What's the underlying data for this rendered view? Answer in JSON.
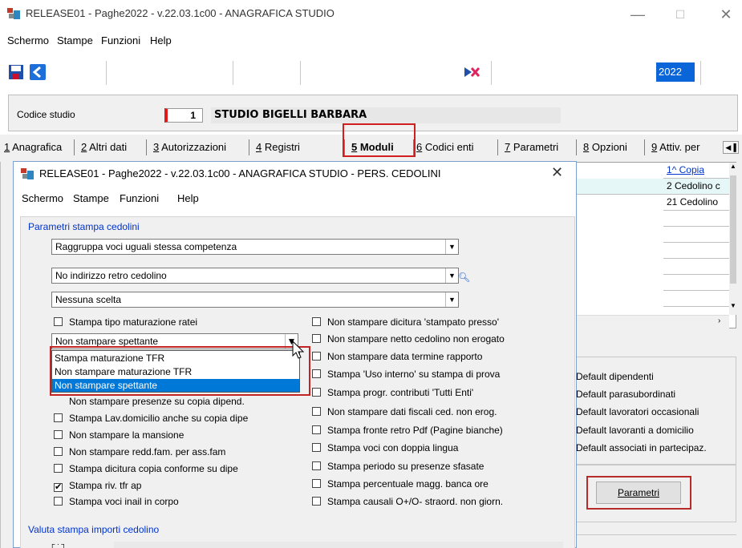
{
  "main": {
    "title": "RELEASE01 - Paghe2022 - v.22.03.1c00 - ANAGRAFICA STUDIO",
    "menu": [
      "Schermo",
      "Stampe",
      "Funzioni",
      "Help"
    ],
    "year": "2022",
    "studio_label": "Codice studio",
    "studio_code": "1",
    "studio_name": "STUDIO BIGELLI BARBARA"
  },
  "tabs": [
    {
      "num": "1",
      "label": " Anagrafica"
    },
    {
      "num": "2",
      "label": " Altri dati"
    },
    {
      "num": "3",
      "label": " Autorizzazioni"
    },
    {
      "num": "4",
      "label": " Registri"
    },
    {
      "num": "5",
      "label": " Moduli"
    },
    {
      "num": "6",
      "label": " Codici enti"
    },
    {
      "num": "7",
      "label": " Parametri"
    },
    {
      "num": "8",
      "label": " Opzioni"
    },
    {
      "num": "9",
      "label": " Attiv. per"
    }
  ],
  "grid": {
    "rows": [
      "1^ Copia",
      "2 Cedolino c",
      "21 Cedolino"
    ]
  },
  "defaults": [
    "Default dipendenti",
    "Default parasubordinati",
    "Default lavoratori occasionali",
    "Default lavoranti a domicilio",
    "Default associati in partecipaz."
  ],
  "parametri_button": "Parametri",
  "dialog": {
    "title": "RELEASE01 - Paghe2022 - v.22.03.1c00 - ANAGRAFICA STUDIO - PERS. CEDOLINI",
    "menu": [
      "Schermo",
      "Stampe",
      "Funzioni",
      "Help"
    ],
    "group_title": "Parametri stampa cedolini",
    "combo1": "Raggruppa voci uguali stessa competenza",
    "combo2": "No indirizzo retro cedolino",
    "combo3": "Nessuna scelta",
    "combo4": "Non stampare spettante",
    "dropdown_options": [
      "Stampa maturazione TFR",
      "Non stampare maturazione TFR",
      "Non stampare spettante"
    ],
    "left_checks": [
      {
        "label": "Stampa tipo maturazione ratei",
        "checked": false
      },
      {
        "label": "Non stampare presenze su copia dipend.",
        "checked": false
      },
      {
        "label": "Stampa Lav.domicilio anche su copia dipe",
        "checked": false
      },
      {
        "label": "Non stampare la mansione",
        "checked": false
      },
      {
        "label": "Non stampare redd.fam. per ass.fam",
        "checked": false
      },
      {
        "label": "Stampa dicitura copia conforme su dipe",
        "checked": false
      },
      {
        "label": "Stampa riv. tfr ap",
        "checked": true
      },
      {
        "label": "Stampa voci inail in corpo",
        "checked": false
      }
    ],
    "right_checks": [
      {
        "label": "Non stampare dicitura 'stampato presso'",
        "checked": false
      },
      {
        "label": "Non stampare netto cedolino non erogato",
        "checked": false
      },
      {
        "label": "Non stampare data termine rapporto",
        "checked": false
      },
      {
        "label": "Stampa 'Uso interno' su stampa di prova",
        "checked": false
      },
      {
        "label": "Stampa progr. contributi 'Tutti Enti'",
        "checked": false
      },
      {
        "label": "Non stampare dati fiscali ced. non erog.",
        "checked": false
      },
      {
        "label": "Stampa fronte retro Pdf (Pagine bianche)",
        "checked": false
      },
      {
        "label": "Stampa voci con doppia lingua",
        "checked": false
      },
      {
        "label": "Stampa periodo su presenze sfasate",
        "checked": false
      },
      {
        "label": "Stampa percentuale magg. banca ore",
        "checked": false
      },
      {
        "label": "Stampa causali O+/O- straord. non giorn.",
        "checked": false
      }
    ],
    "valuta_label": "Valuta stampa importi cedolino"
  }
}
